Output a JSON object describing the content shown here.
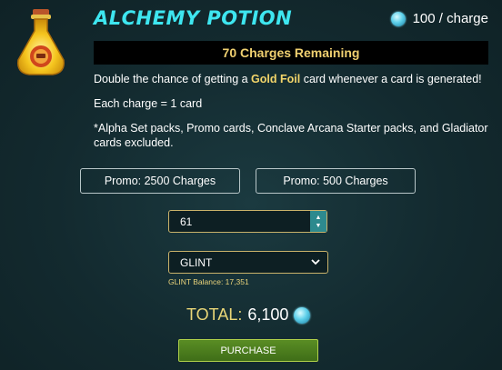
{
  "header": {
    "title": "ALCHEMY POTION",
    "price": "100 / charge",
    "price_icon": "credits-icon"
  },
  "charges_remaining": "70 Charges Remaining",
  "description": {
    "line1_before": "Double the chance of getting a ",
    "line1_bold": "Gold Foil",
    "line1_after": " card whenever a card is generated!",
    "line2": "Each charge = 1 card",
    "line3": "*Alpha Set packs, Promo cards, Conclave Arcana Starter packs, and Gladiator cards excluded."
  },
  "promos": [
    {
      "label": "Promo: 2500 Charges"
    },
    {
      "label": "Promo: 500 Charges"
    }
  ],
  "quantity": {
    "value": "61"
  },
  "currency_select": {
    "selected": "GLINT"
  },
  "balance": "GLINT Balance: 17,351",
  "total": {
    "label": "TOTAL:",
    "value": "6,100"
  },
  "purchase_label": "PURCHASE",
  "colors": {
    "title": "#3ee6f0",
    "charges_text": "#f0d070",
    "purchase_bg": "#4f7f1e",
    "background": "#12282c"
  }
}
